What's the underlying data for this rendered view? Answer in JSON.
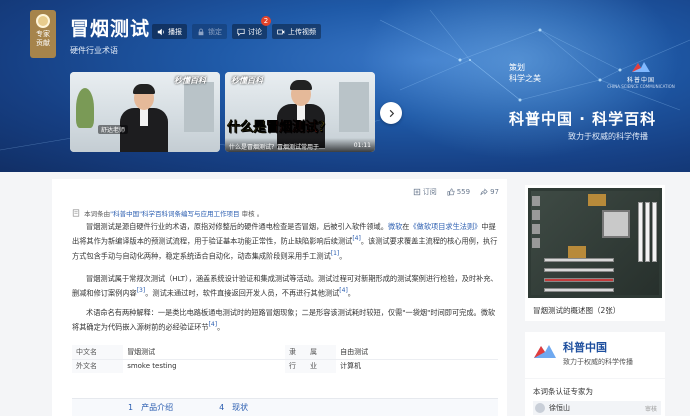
{
  "badge": {
    "line1": "专家",
    "line2": "贡献"
  },
  "entry": {
    "title": "冒烟测试",
    "subtitle": "硬件行业术语"
  },
  "toolbar": {
    "play": "播报",
    "lock": "锁定",
    "discuss": "讨论",
    "discuss_count": "2",
    "upload": "上传视频"
  },
  "credit": {
    "label": "策划",
    "value": "科学之美"
  },
  "videos": [
    {
      "presenter": "舒达老师",
      "logo": "秒懂百科"
    },
    {
      "logo": "秒懂百科",
      "headline_a": "什么是",
      "headline_b": "冒烟测试",
      "headline_c": "？",
      "caption": "什么是冒烟测试？冒烟测试常用于…",
      "duration": "01:11"
    }
  ],
  "brand": {
    "logo_name": "科普中国",
    "logo_en": "CHINA SCIENCE COMMUNICATION",
    "title": "科普中国 · 科学百科",
    "tagline": "致力于权威的科学传播"
  },
  "stats": {
    "subscribe": "订阅",
    "likes": "559",
    "shares": "97"
  },
  "source": {
    "prefix": "本词条由",
    "link": "\"科普中国\"科学百科词条编写与应用工作项目",
    "suffix": " 审核 。"
  },
  "paragraphs": [
    {
      "a": "冒烟测试是源自硬件行业的术语，原指对修整后的硬件通电检查是否冒烟，后被引入软件领域。",
      "link1": "微软",
      "b": "在",
      "link2": "《做软项目求生法则》",
      "c": "中提出将其作为新编译版本的预测试流程，用于验证基本功能正常性，防止缺陷影响后续测试",
      "ref1": "[4]",
      "d": "。该测试要求覆盖主流程的核心用例，执行方式包含手动与自动化两种，稳定系统适合自动化，动态集成阶段则采用手工测试",
      "ref2": "[1]",
      "e": "。"
    },
    {
      "a": "冒烟测试属于常规次测试（HLT），涵盖系统设计验证和集成测试等活动。测试过程可对新期形成的测试案例进行检验，及时补充、删减和修订案例内容",
      "ref1": "[3]",
      "b": "。测试未通过时，软件直接返回开发人员，不再进行其他测试",
      "ref2": "[4]",
      "c": "。"
    },
    {
      "a": "术语命名有两种解释：一是类比电路板通电测试时的短路冒烟现象；二是形容该测试耗时较短，仅需\"一袋烟\"时间即可完成。微软将其确定为代码嵌入源树前的必经验证环节",
      "ref1": "[4]",
      "b": "。"
    }
  ],
  "infobox": [
    {
      "k1": "中文名",
      "v1": "冒烟测试",
      "k2": "隶　　属",
      "v2": "自由测试"
    },
    {
      "k1": "外文名",
      "v1": "smoke testing",
      "k2": "行　　业",
      "v2": "计算机"
    }
  ],
  "toc": [
    "1　产品介绍",
    "4　现状"
  ],
  "album": {
    "caption": "冒烟测试的概述图（2张）"
  },
  "side_brand": {
    "name": "科普中国",
    "tagline": "致力于权威的科学传播"
  },
  "expert": {
    "heading": "本词条认证专家为",
    "name": "徐恒山",
    "status": "审核"
  }
}
